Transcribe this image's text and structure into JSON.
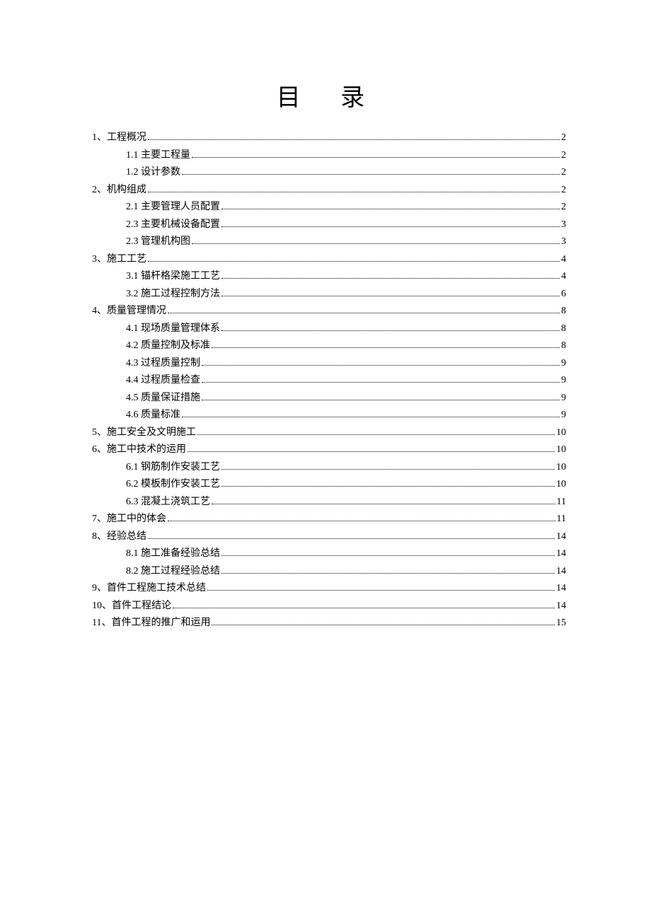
{
  "title": "目 录",
  "toc": [
    {
      "level": 0,
      "label": "1、工程概况",
      "page": "2"
    },
    {
      "level": 1,
      "label": "1.1 主要工程量",
      "page": "2"
    },
    {
      "level": 1,
      "label": "1.2 设计参数",
      "page": "2"
    },
    {
      "level": 0,
      "label": "2、机构组成",
      "page": "2"
    },
    {
      "level": 1,
      "label": "2.1 主要管理人员配置",
      "page": "2"
    },
    {
      "level": 1,
      "label": "2.3 主要机械设备配置",
      "page": "3"
    },
    {
      "level": 1,
      "label": "2.3 管理机构图",
      "page": "3"
    },
    {
      "level": 0,
      "label": "3、施工工艺",
      "page": "4"
    },
    {
      "level": 1,
      "label": "3.1 锚杆格梁施工工艺",
      "page": "4"
    },
    {
      "level": 1,
      "label": "3.2 施工过程控制方法",
      "page": "6"
    },
    {
      "level": 0,
      "label": "4、质量管理情况",
      "page": "8"
    },
    {
      "level": 1,
      "label": "4.1 现场质量管理体系",
      "page": "8"
    },
    {
      "level": 1,
      "label": "4.2 质量控制及标准",
      "page": "8"
    },
    {
      "level": 1,
      "label": "4.3 过程质量控制",
      "page": "9"
    },
    {
      "level": 1,
      "label": "4.4 过程质量检查",
      "page": "9"
    },
    {
      "level": 1,
      "label": "4.5 质量保证措施",
      "page": "9"
    },
    {
      "level": 1,
      "label": "4.6 质量标准",
      "page": "9"
    },
    {
      "level": 0,
      "label": "5、施工安全及文明施工",
      "page": "10"
    },
    {
      "level": 0,
      "label": "6、施工中技术的运用",
      "page": "10"
    },
    {
      "level": 1,
      "label": "6.1 钢筋制作安装工艺",
      "page": "10"
    },
    {
      "level": 1,
      "label": "6.2 模板制作安装工艺",
      "page": "10"
    },
    {
      "level": 1,
      "label": "6.3 混凝土浇筑工艺",
      "page": "11"
    },
    {
      "level": 0,
      "label": "7、施工中的体会",
      "page": "11"
    },
    {
      "level": 0,
      "label": "8、经验总结",
      "page": "14"
    },
    {
      "level": 1,
      "label": "8.1 施工准备经验总结",
      "page": "14"
    },
    {
      "level": 1,
      "label": "8.2 施工过程经验总结",
      "page": "14"
    },
    {
      "level": 0,
      "label": "9、首件工程施工技术总结",
      "page": "14"
    },
    {
      "level": 0,
      "label": "10、首件工程结论",
      "page": "14"
    },
    {
      "level": 0,
      "label": "11、首件工程的推广和运用",
      "page": "15"
    }
  ]
}
